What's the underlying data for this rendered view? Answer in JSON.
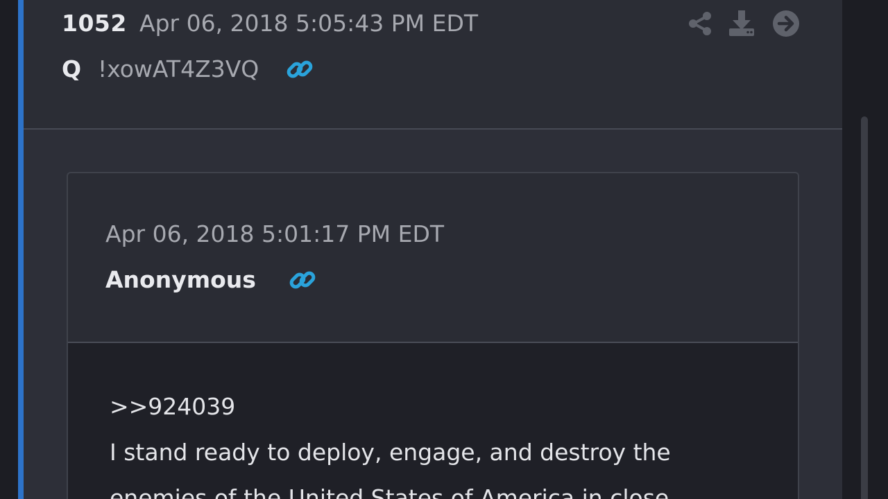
{
  "post": {
    "number": "1052",
    "date": "Apr 06, 2018 5:05:43 PM EDT",
    "author": "Q",
    "tripcode": "!xowAT4Z3VQ",
    "icons": {
      "link": "link-icon",
      "share": "share-icon",
      "download": "download-icon",
      "next": "arrow-right-circle-icon"
    }
  },
  "quoted_post": {
    "date": "Apr 06, 2018 5:01:17 PM EDT",
    "author": "Anonymous",
    "body_lines": [
      ">>924039",
      "I stand ready to deploy, engage, and destroy the",
      "enemies of the United States of America in close"
    ]
  },
  "colors": {
    "accent": "#2d73c9",
    "link_icon": "#2aa3db",
    "background": "#1c1d23",
    "card": "#2d2f38"
  }
}
